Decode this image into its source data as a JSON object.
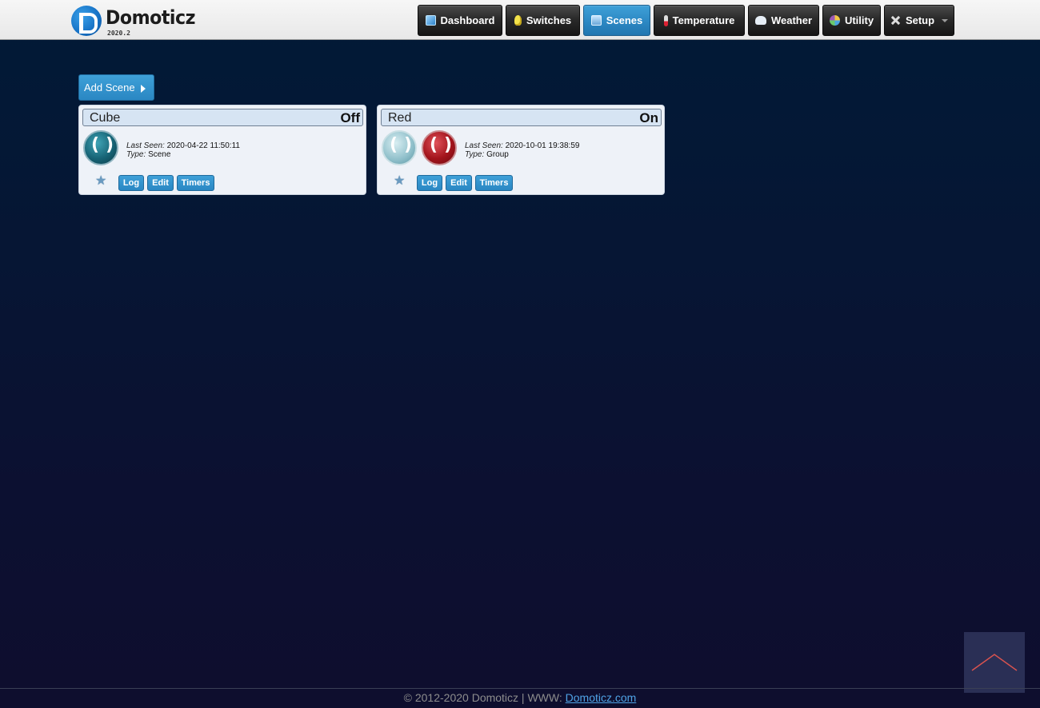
{
  "app": {
    "name": "Domoticz",
    "version": "2020.2"
  },
  "nav": {
    "items": [
      {
        "label": "Dashboard",
        "icon": "dashboard-icon",
        "active": false
      },
      {
        "label": "Switches",
        "icon": "lightbulb-icon",
        "active": false
      },
      {
        "label": "Scenes",
        "icon": "scenes-icon",
        "active": true
      },
      {
        "label": "Temperature",
        "icon": "thermometer-icon",
        "active": false
      },
      {
        "label": "Weather",
        "icon": "cloud-icon",
        "active": false
      },
      {
        "label": "Utility",
        "icon": "utility-icon",
        "active": false
      },
      {
        "label": "Setup",
        "icon": "tools-icon",
        "active": false
      }
    ]
  },
  "toolbar": {
    "add_scene_label": "Add Scene"
  },
  "scenes": [
    {
      "name": "Cube",
      "status": "Off",
      "last_seen_label": "Last Seen:",
      "last_seen": "2020-04-22 11:50:11",
      "type_label": "Type:",
      "type": "Scene",
      "buttons": {
        "log": "Log",
        "edit": "Edit",
        "timers": "Timers"
      }
    },
    {
      "name": "Red",
      "status": "On",
      "last_seen_label": "Last Seen:",
      "last_seen": "2020-10-01 19:38:59",
      "type_label": "Type:",
      "type": "Group",
      "buttons": {
        "log": "Log",
        "edit": "Edit",
        "timers": "Timers"
      }
    }
  ],
  "footer": {
    "text": "© 2012-2020 Domoticz | WWW:",
    "link": "Domoticz.com"
  },
  "colors": {
    "accent": "#2b86c1",
    "nav_dark": "#1e1e1e",
    "background": "#061634",
    "scene_off": "#176476",
    "scene_on": "#a3141c"
  }
}
